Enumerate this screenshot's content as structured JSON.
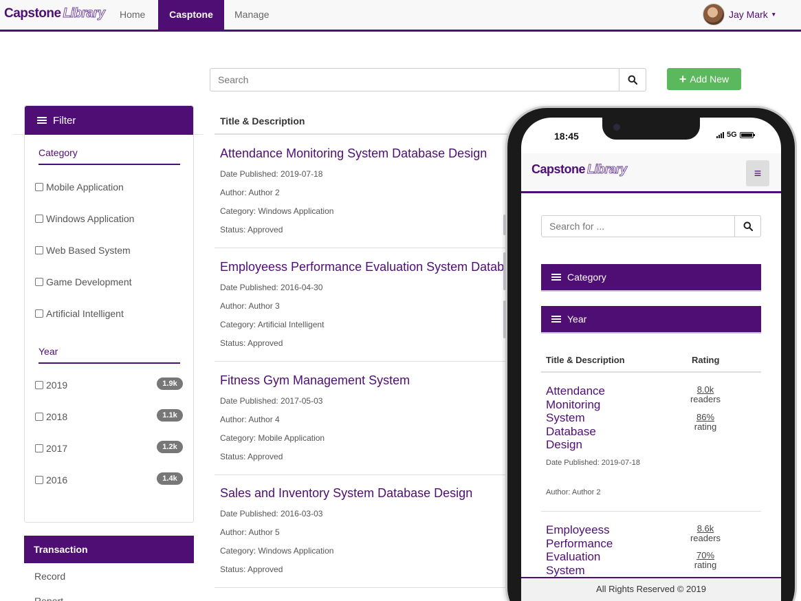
{
  "nav": {
    "logo_main": "Capstone",
    "logo_sub": "Library",
    "items": [
      {
        "label": "Home"
      },
      {
        "label": "Casptone"
      },
      {
        "label": "Manage"
      }
    ],
    "user_name": "Jay Mark",
    "user_caret": "▾"
  },
  "search": {
    "placeholder": "Search",
    "icon": "search-icon"
  },
  "add_button": {
    "icon": "plus-icon",
    "label": "Add New",
    "color": "#5cb85c"
  },
  "filter": {
    "title": "Filter",
    "icon": "list-icon",
    "category_label": "Category",
    "categories": [
      {
        "label": "Mobile Application"
      },
      {
        "label": "Windows Application"
      },
      {
        "label": "Web Based System"
      },
      {
        "label": "Game Development"
      },
      {
        "label": "Artificial Intelligent"
      }
    ],
    "year_label": "Year",
    "years": [
      {
        "label": "2019",
        "count": "1.9k"
      },
      {
        "label": "2018",
        "count": "1.1k"
      },
      {
        "label": "2017",
        "count": "1.2k"
      },
      {
        "label": "2016",
        "count": "1.4k"
      }
    ]
  },
  "transaction": {
    "title": "Transaction",
    "links": [
      {
        "label": "Record"
      },
      {
        "label": "Report"
      }
    ]
  },
  "list": {
    "column_header": "Title & Description",
    "items": [
      {
        "title": "Attendance Monitoring System Database Design",
        "date": "Date Published: 2019-07-18",
        "author": "Author: Author 2",
        "category": "Category: Windows Application",
        "status": "Status: Approved"
      },
      {
        "title": "Employeess Performance Evaluation System Database Design",
        "date": "Date Published: 2016-04-30",
        "author": "Author: Author 3",
        "category": "Category: Artificial Intelligent",
        "status": "Status: Approved"
      },
      {
        "title": "Fitness Gym Management System",
        "date": "Date Published: 2017-05-03",
        "author": "Author: Author 4",
        "category": "Category: Mobile Application",
        "status": "Status: Approved"
      },
      {
        "title": "Sales and Inventory System Database Design",
        "date": "Date Published: 2016-03-03",
        "author": "Author: Author 5",
        "category": "Category: Windows Application",
        "status": "Status: Approved"
      }
    ]
  },
  "mobile": {
    "time": "18:45",
    "network": "5G",
    "logo_main": "Capstone",
    "logo_sub": "Library",
    "menu_icon": "≡",
    "search_placeholder": "Search for ...",
    "accordions": [
      {
        "label": "Category"
      },
      {
        "label": "Year"
      }
    ],
    "col_title": "Title & Description",
    "col_rating": "Rating",
    "items": [
      {
        "title": "Attendance Monitoring System Database Design",
        "date": "Date Published: 2019-07-18",
        "author": "Author: Author 2",
        "readers": "8.0k",
        "readers_label": "readers",
        "rating": "86%",
        "rating_label": "rating"
      },
      {
        "title": "Employeess Performance Evaluation System",
        "readers": "8.6k",
        "readers_label": "readers",
        "rating": "70%",
        "rating_label": "rating"
      }
    ],
    "footer": "All Rights Reserved © 2019"
  },
  "colors": {
    "brand_purple": "#4f0e73",
    "success_green": "#5cb85c",
    "badge_gray": "#777777"
  }
}
